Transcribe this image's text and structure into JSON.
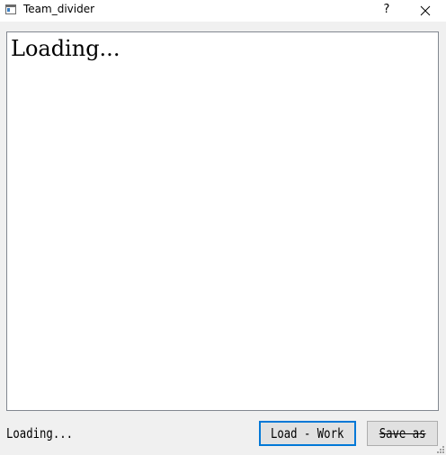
{
  "window": {
    "title": "Team_divider",
    "help_glyph": "?",
    "app_icon": "app-window-icon",
    "close_icon": "close-icon"
  },
  "content": {
    "text": "Loading..."
  },
  "status": {
    "text": "Loading..."
  },
  "buttons": {
    "load_label": "Load - Work",
    "save_label": "Save as"
  },
  "colors": {
    "focus_border": "#0078d7",
    "button_face": "#e1e1e1",
    "window_bg": "#f0f0f0"
  }
}
